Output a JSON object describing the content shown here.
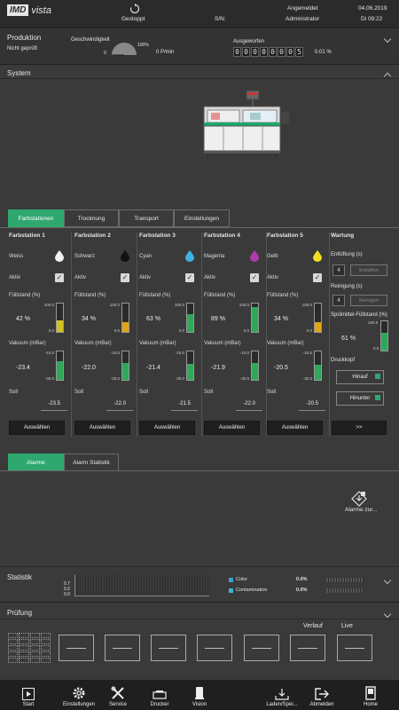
{
  "header": {
    "logo_brand": "IMD",
    "logo_product": "vista",
    "machine_state": "Gestoppt",
    "sn_label": "S/N:",
    "login_label": "Angemeldet",
    "user": "Administrator",
    "date": "04.06.2019",
    "time": "Di 09:22"
  },
  "produktion": {
    "title": "Produktion",
    "status": "Nicht geprüft",
    "speed_label": "Geschwindigkeit",
    "speed_min": "0",
    "speed_max": "100%",
    "speed_value": "0 P/min",
    "ejected_label": "Ausgeworfen",
    "counter_digits": [
      "0",
      "0",
      "0",
      "0",
      "0",
      "0",
      "0",
      "5"
    ],
    "ejected_percent": "0.01 %"
  },
  "system": {
    "title": "System"
  },
  "tabs": {
    "farbstationen": "Farbstationen",
    "trocknung": "Trocknung",
    "transport": "Transport",
    "einstellungen": "Einstellungen"
  },
  "labels": {
    "aktiv": "Aktiv",
    "fuellstand": "Füllstand (%)",
    "vakuum": "Vakuum (mBar)",
    "soll": "Soll",
    "auswaehlen": "Auswählen",
    "gauge_fill_top": "100.0",
    "gauge_fill_bottom": "0.0",
    "gauge_vac_top": "-10.0",
    "gauge_vac_bottom": "-30.0"
  },
  "stations": [
    {
      "title": "Farbstation 1",
      "color_name": "Weiss",
      "fill": "42 %",
      "fill_level": 42,
      "vacuum": "-23.4",
      "vacuum_level": 0.67,
      "soll": "-23.5",
      "drop_color": "#f2f2f2",
      "bar_color": "#d2c21c"
    },
    {
      "title": "Farbstation 2",
      "color_name": "Schwarz",
      "fill": "34 %",
      "fill_level": 34,
      "vacuum": "-22.0",
      "vacuum_level": 0.6,
      "soll": "-22.0",
      "drop_color": "#111111",
      "bar_color": "#e1a415"
    },
    {
      "title": "Farbstation 3",
      "color_name": "Cyan",
      "fill": "63 %",
      "fill_level": 63,
      "vacuum": "-21.4",
      "vacuum_level": 0.57,
      "soll": "-21.5",
      "drop_color": "#3fb2e0",
      "bar_color": "#2fa85a"
    },
    {
      "title": "Farbstation 4",
      "color_name": "Magenta",
      "fill": "89 %",
      "fill_level": 89,
      "vacuum": "-21.9",
      "vacuum_level": 0.6,
      "soll": "-22.0",
      "drop_color": "#b03aa8",
      "bar_color": "#2fa85a"
    },
    {
      "title": "Farbstation 5",
      "color_name": "Gelb",
      "fill": "34 %",
      "fill_level": 34,
      "vacuum": "-20.5",
      "vacuum_level": 0.53,
      "soll": "-20.5",
      "drop_color": "#f0e020",
      "bar_color": "#e1a415"
    }
  ],
  "wartung": {
    "title": "Wartung",
    "entlueftung_label": "Entlüftung (s)",
    "entlueftung_value": "4",
    "entlueften_btn": "Entlüften",
    "reinigung_label": "Reinigung (s)",
    "reinigung_value": "4",
    "reinigen_btn": "Reinigen",
    "spuel_label": "Spülmittel-Füllstand (%)",
    "spuel_value": "61 %",
    "spuel_level": 61,
    "druckkopf_label": "Druckkopf",
    "hinauf": "Hinauf",
    "hinunter": "Hinunter",
    "more_btn": ">>"
  },
  "alarm_tabs": {
    "alarme": "Alarme",
    "statistik": "Alarm Statistik"
  },
  "alarm_action": "Alarme zur...",
  "statistik": {
    "title": "Statistik",
    "y_ticks": [
      "0.7",
      "0.2",
      "0.0"
    ],
    "color_label": "Color",
    "color_value": "0.0%",
    "contamination_label": "Contamination",
    "contamination_value": "0.0%",
    "color_swatch": "#3aa0d8",
    "contamination_swatch": "#3ab6c8"
  },
  "pruefung": {
    "title": "Prüfung",
    "verlauf": "Verlauf",
    "live": "Live"
  },
  "nav": {
    "start": "Start",
    "einstellungen": "Einstellungen",
    "service": "Service",
    "drucker": "Drucker",
    "vision": "Vision",
    "laden": "Laden/Spei...",
    "abmelden": "Abmelden",
    "home": "Home"
  }
}
